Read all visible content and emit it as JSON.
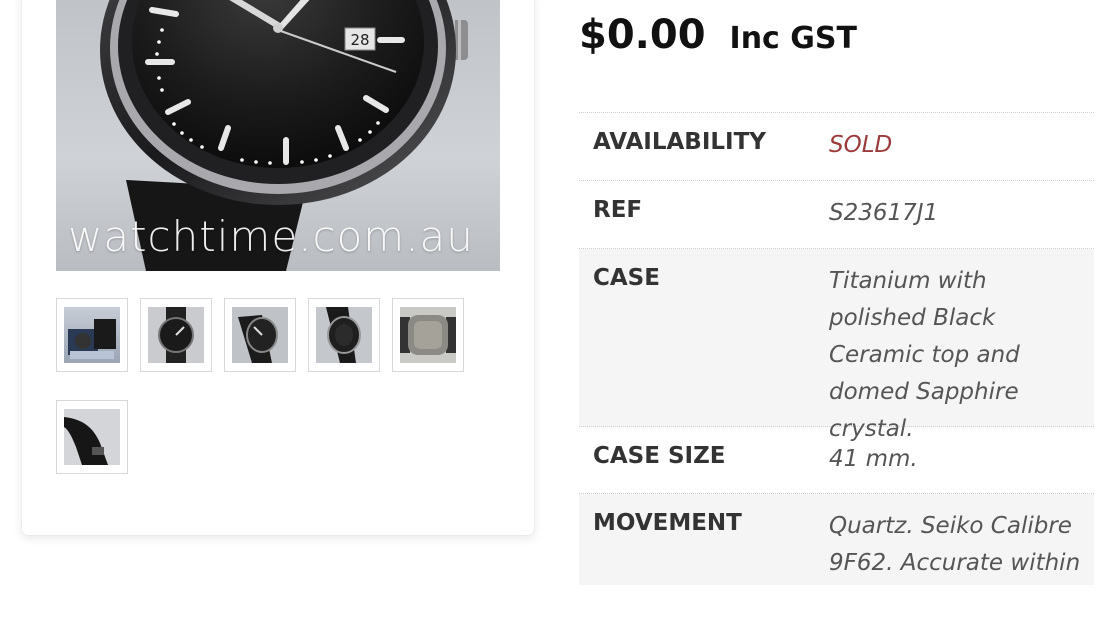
{
  "product": {
    "price": "$0.00",
    "price_suffix": "Inc GST"
  },
  "gallery": {
    "watermark": "watchtime.com.au",
    "date_window": "28",
    "thumbnails": [
      {
        "name": "thumbnail-box-and-papers",
        "alt": "Watch in presentation box"
      },
      {
        "name": "thumbnail-watch-front",
        "alt": "Watch front view"
      },
      {
        "name": "thumbnail-watch-angle",
        "alt": "Watch angled view"
      },
      {
        "name": "thumbnail-watch-side",
        "alt": "Watch side view"
      },
      {
        "name": "thumbnail-caseback",
        "alt": "Watch caseback"
      },
      {
        "name": "thumbnail-strap",
        "alt": "Watch strap"
      }
    ]
  },
  "specs": [
    {
      "label": "AVAILABILITY",
      "value": "SOLD"
    },
    {
      "label": "REF",
      "value": "S23617J1"
    },
    {
      "label": "CASE",
      "value": "Titanium with polished Black Ceramic top and domed Sapphire crystal."
    },
    {
      "label": "CASE SIZE",
      "value": "41 mm."
    },
    {
      "label": "MOVEMENT",
      "value": "Quartz. Seiko Calibre 9F62. Accurate within"
    }
  ],
  "colors": {
    "sold": "#9b3b3b",
    "row_alt": "#f5f5f5",
    "text_dark": "#111111"
  }
}
